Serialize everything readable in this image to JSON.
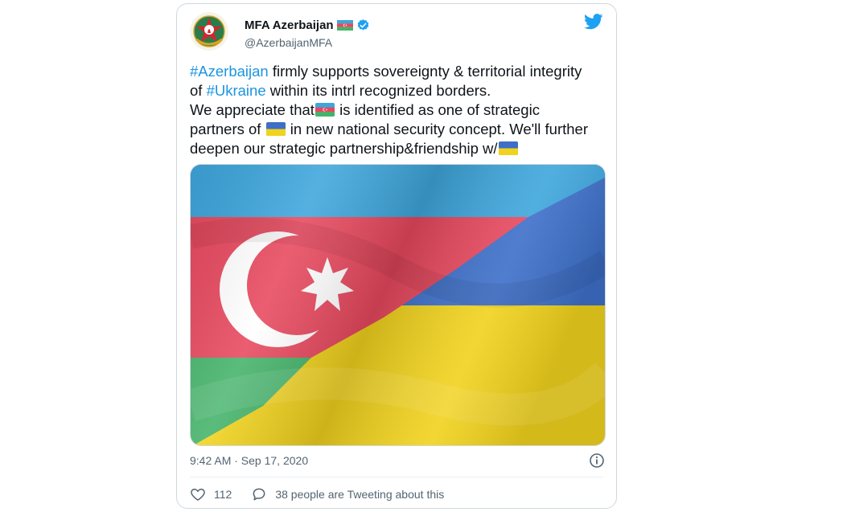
{
  "tweet": {
    "author": {
      "display_name": "MFA Azerbaijan",
      "handle": "@AzerbaijanMFA",
      "verified": true,
      "name_emoji": "azerbaijan-flag",
      "avatar": "mfa-azerbaijan-emblem"
    },
    "text": {
      "hashtag_1": "#Azerbaijan",
      "line_1_rest": " firmly supports sovereignty & territorial integrity",
      "line_2_pre": "of ",
      "hashtag_2": "#Ukraine",
      "line_2_rest": " within its intrl recognized borders.",
      "line_3_pre": "We appreciate that",
      "line_3_post": " is identified as one of strategic",
      "line_4_pre": "partners of ",
      "line_4_post": " in new national security concept. We'll further",
      "line_5_pre": "deepen our strategic partnership&friendship w/"
    },
    "media": {
      "description_icon": "waving-flags-azerbaijan-ukraine"
    },
    "timestamp": "9:42 AM · Sep 17, 2020",
    "likes_count": "112",
    "tweeting_about": "38 people are Tweeting about this"
  },
  "colors": {
    "hashtag": "#1b95e0",
    "verified": "#1da1f2",
    "az_blue": "#3ea6dc",
    "az_red": "#e8485e",
    "az_green": "#44b36a",
    "ua_blue": "#3d6fc9",
    "ua_yellow": "#f1d21d"
  }
}
